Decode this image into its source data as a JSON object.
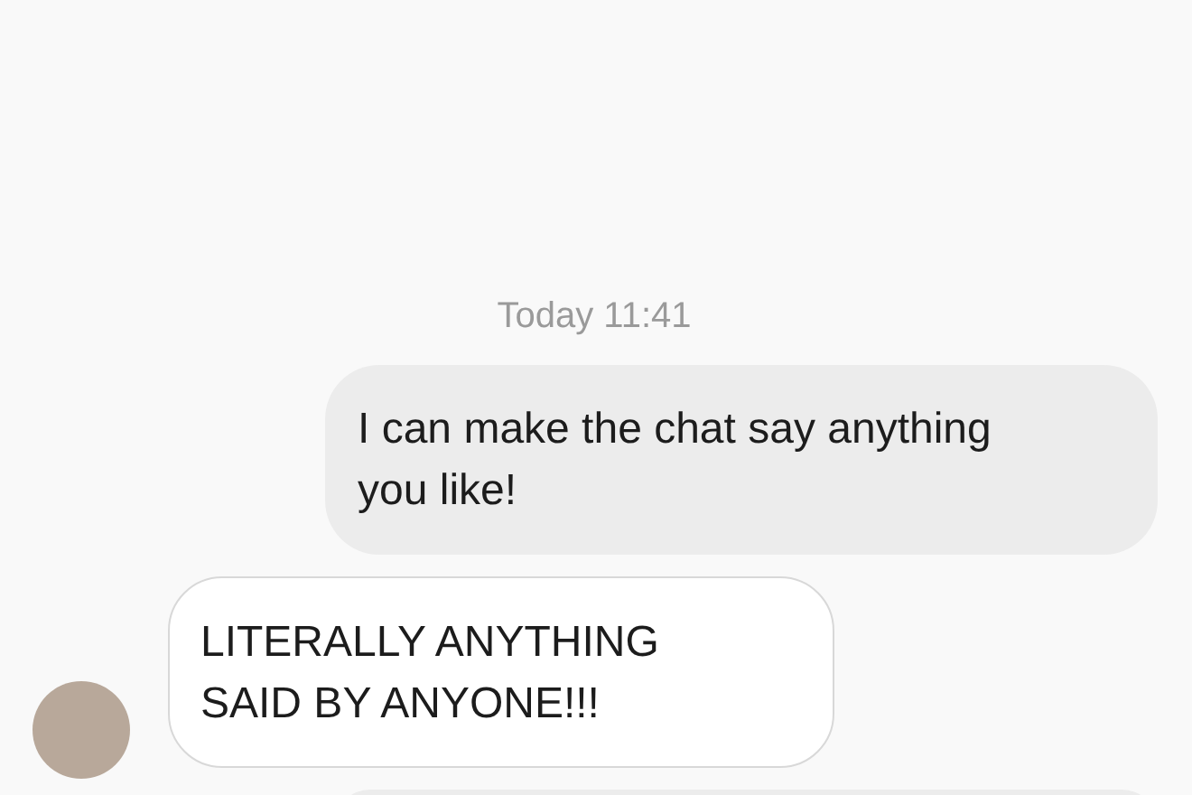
{
  "timestamp": "Today 11:41",
  "messages": [
    {
      "kind": "outgoing",
      "text": "I can make the chat say anything you like!"
    },
    {
      "kind": "incoming",
      "text": "LITERALLY ANYTHING SAID BY ANYONE!!!",
      "avatar": true
    },
    {
      "kind": "outgoing"
    }
  ]
}
